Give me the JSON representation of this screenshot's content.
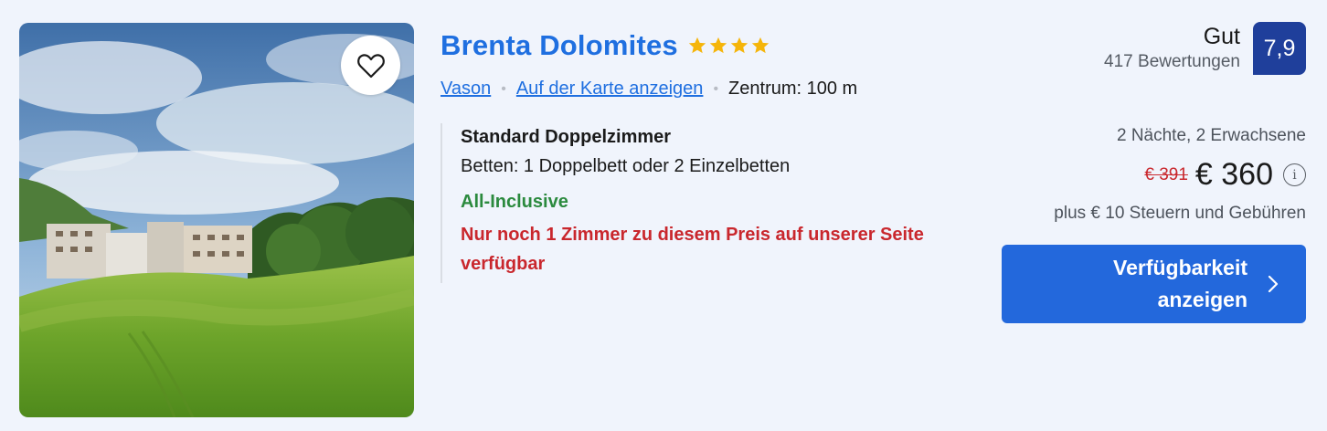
{
  "hotel": {
    "name": "Brenta Dolomites",
    "star_rating": 4,
    "favorite_icon": "heart-outline-icon",
    "location_link": "Vason",
    "map_link": "Auf der Karte anzeigen",
    "distance": "Zentrum: 100 m"
  },
  "room": {
    "name": "Standard Doppelzimmer",
    "beds": "Betten: 1 Doppelbett oder 2 Einzelbetten",
    "board": "All-Inclusive",
    "scarcity": "Nur noch 1 Zimmer zu diesem Preis auf unserer Seite verfügbar"
  },
  "rating": {
    "word": "Gut",
    "reviews": "417 Bewertungen",
    "score": "7,9"
  },
  "price": {
    "stay": "2 Nächte, 2 Erwachsene",
    "old": "€ 391",
    "current": "€ 360",
    "info_icon": "info-icon",
    "taxes": "plus € 10 Steuern und Gebühren"
  },
  "cta": {
    "label": "Verfügbarkeit anzeigen",
    "icon": "chevron-right-icon"
  },
  "colors": {
    "link_blue": "#1f6fe0",
    "score_bg": "#1f3f9b",
    "cta_bg": "#2368dc",
    "green": "#2b8a3e",
    "red": "#c9272d",
    "star": "#f5b50a",
    "page_bg": "#f0f4fc"
  }
}
